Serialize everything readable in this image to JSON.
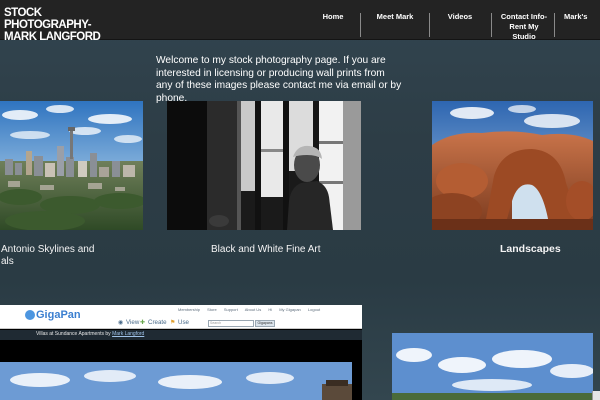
{
  "site": {
    "title": "STOCK PHOTOGRAPHY-MARK LANGFORD"
  },
  "nav": {
    "items": [
      {
        "label": "Home"
      },
      {
        "label": "Meet Mark"
      },
      {
        "label": "Videos"
      },
      {
        "label": "Contact Info-Rent My Studio"
      },
      {
        "label": "Mark's"
      }
    ]
  },
  "welcome": {
    "text": "Welcome to my stock photography page. If you are interested in licensing or producing wall prints from any of these images please contact me via email or by phone."
  },
  "galleries": [
    {
      "caption_line1": "Antonio Skylines and",
      "caption_line2": "als",
      "photo": "san-antonio-skyline"
    },
    {
      "caption_line1": "Black and White Fine Art",
      "photo": "black-and-white-portrait"
    },
    {
      "caption_line1": "Landscapes",
      "photo": "red-rock-arch"
    }
  ],
  "gigapan": {
    "logo": "GigaPan",
    "links": [
      "Membership",
      "Store",
      "Support",
      "About Us",
      "Hi",
      "My Gigapan",
      "Logout"
    ],
    "actions": {
      "view": "View",
      "create": "Create",
      "use": "Use"
    },
    "search_placeholder": "Search",
    "search_button": "Gigapans",
    "subtitle_prefix": "Villas at Sundance Apartments by",
    "subtitle_author": "Mark Langford"
  },
  "colors": {
    "topbar": "#232323",
    "page_background": "#2d3d46",
    "gigapan_blue": "#3b7fd0"
  }
}
